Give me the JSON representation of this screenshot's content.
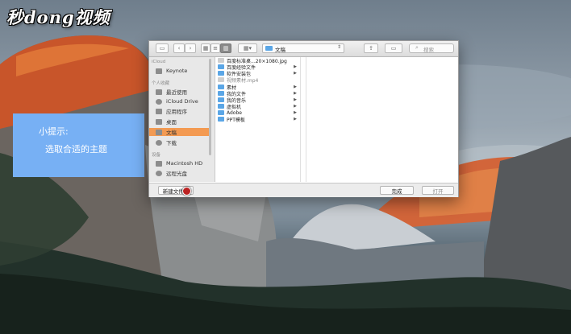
{
  "watermark": {
    "logo_text": "秒dong视频"
  },
  "tip": {
    "title": "小提示:",
    "body": "选取合适的主题"
  },
  "dialog": {
    "toolbar": {
      "sidebar_toggle_icon": "sidebar-icon",
      "back_icon": "chevron-left-icon",
      "forward_icon": "chevron-right-icon",
      "view_icons": [
        "icon-view",
        "list-view",
        "column-view"
      ],
      "arrange_icon": "arrange-icon",
      "path_label": "文稿",
      "share_icon": "share-icon",
      "tag_icon": "tag-icon",
      "search_placeholder": "搜索"
    },
    "sidebar": {
      "sections": [
        {
          "title": "iCloud",
          "items": [
            {
              "label": "Keynote",
              "icon": "keynote-icon",
              "selected": false
            }
          ]
        },
        {
          "title": "个人收藏",
          "items": [
            {
              "label": "最近使用",
              "icon": "recents-icon",
              "selected": false
            },
            {
              "label": "iCloud Drive",
              "icon": "cloud-icon",
              "selected": false
            },
            {
              "label": "应用程序",
              "icon": "applications-icon",
              "selected": false
            },
            {
              "label": "桌面",
              "icon": "desktop-icon",
              "selected": false
            },
            {
              "label": "文稿",
              "icon": "documents-icon",
              "selected": true
            },
            {
              "label": "下载",
              "icon": "downloads-icon",
              "selected": false
            }
          ]
        },
        {
          "title": "设备",
          "items": [
            {
              "label": "Macintosh HD",
              "icon": "disk-icon",
              "selected": false
            },
            {
              "label": "远程光盘",
              "icon": "remote-disc-icon",
              "selected": false
            }
          ]
        }
      ]
    },
    "files": [
      {
        "name": "百度标准桌...20×1080.jpg",
        "type": "file",
        "dim": false,
        "has_children": false
      },
      {
        "name": "百度经验文件",
        "type": "folder",
        "dim": false,
        "has_children": true
      },
      {
        "name": "软件安装包",
        "type": "folder",
        "dim": false,
        "has_children": true
      },
      {
        "name": "视频素材.mp4",
        "type": "file",
        "dim": true,
        "has_children": false
      },
      {
        "name": "素材",
        "type": "folder",
        "dim": false,
        "has_children": true
      },
      {
        "name": "我的文件",
        "type": "folder",
        "dim": false,
        "has_children": true
      },
      {
        "name": "我的音乐",
        "type": "folder",
        "dim": false,
        "has_children": true
      },
      {
        "name": "虚拟机",
        "type": "folder",
        "dim": false,
        "has_children": true
      },
      {
        "name": "Adobe",
        "type": "folder",
        "dim": false,
        "has_children": true
      },
      {
        "name": "PPT模板",
        "type": "folder",
        "dim": false,
        "has_children": true
      }
    ],
    "buttons": {
      "new_folder": "新建文件夹",
      "done": "完成",
      "open": "打开"
    }
  },
  "colors": {
    "sidebar_selected": "#f39a52",
    "folder": "#5aa6e6",
    "tip_bg": "#77b0f4"
  }
}
